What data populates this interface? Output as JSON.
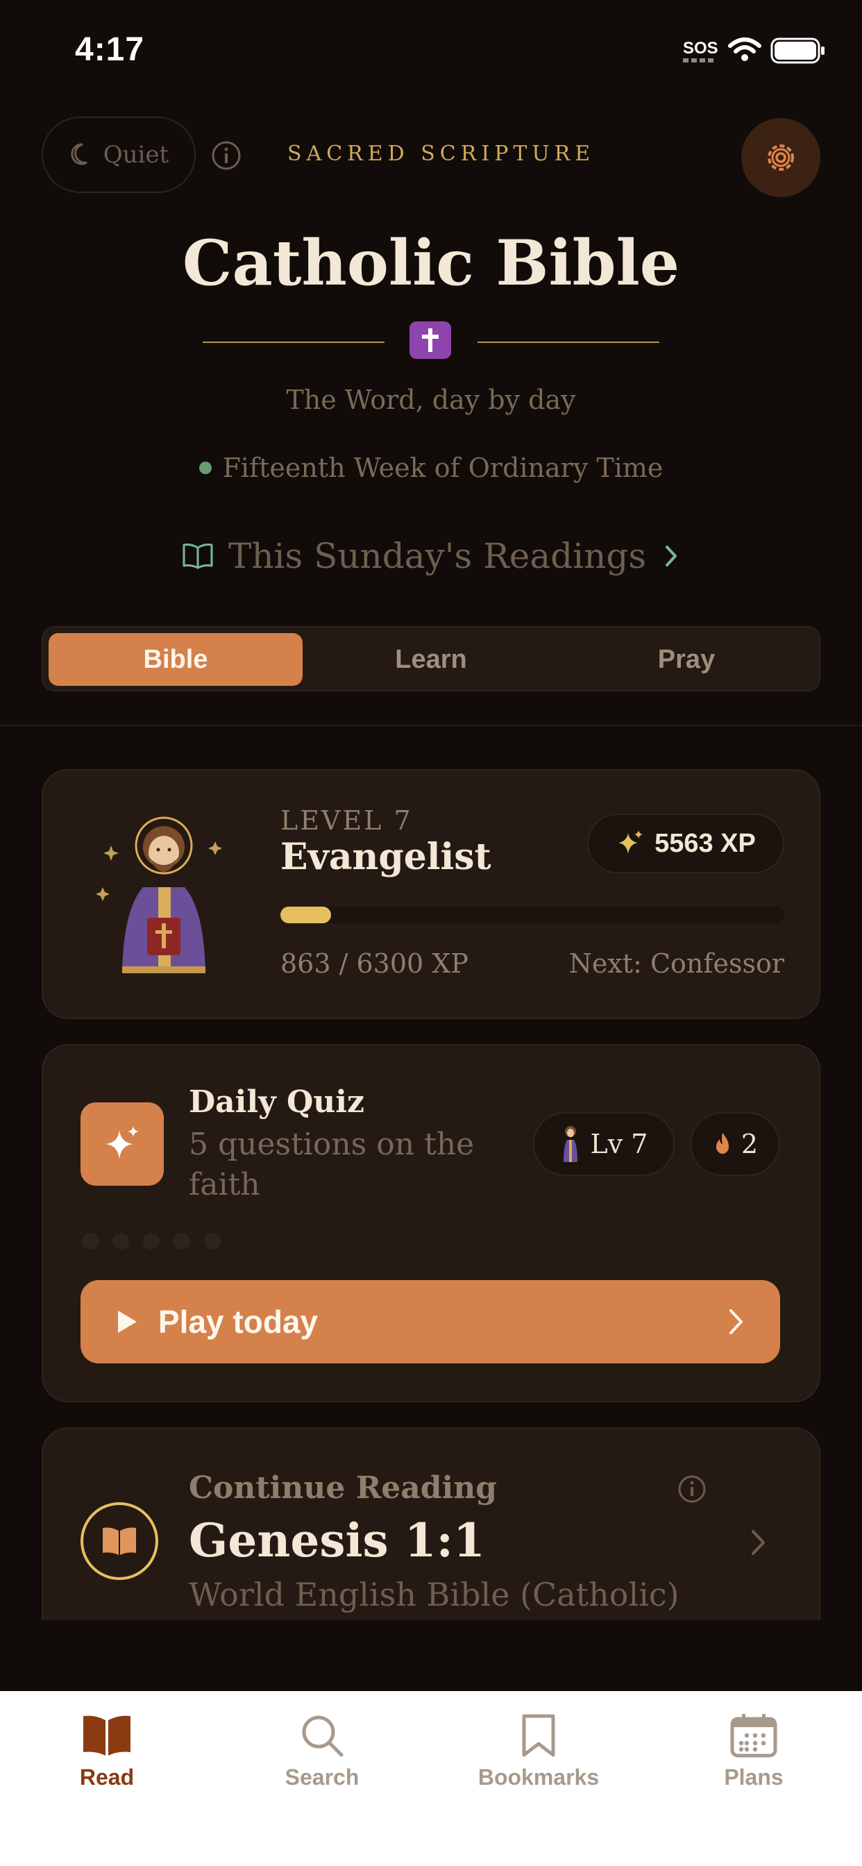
{
  "status_bar": {
    "time": "4:17",
    "sos": "SOS"
  },
  "header": {
    "quiet_label": "Quiet",
    "eyebrow": "SACRED SCRIPTURE",
    "title": "Catholic Bible",
    "subtitle": "The Word, day by day",
    "season": "Fifteenth Week of Ordinary Time",
    "readings_link": "This Sunday's Readings",
    "cross_color": "#8e44ad"
  },
  "segments": [
    {
      "label": "Bible",
      "active": true
    },
    {
      "label": "Learn",
      "active": false
    },
    {
      "label": "Pray",
      "active": false
    }
  ],
  "level_card": {
    "level_label": "LEVEL 7",
    "rank": "Evangelist",
    "xp_total": "5563 XP",
    "progress_text": "863 / 6300 XP",
    "progress_fraction": 0.137,
    "next_rank": "Next: Confessor"
  },
  "quiz": {
    "title": "Daily Quiz",
    "description": "5 questions on the faith",
    "level_pill": "Lv 7",
    "streak": "2",
    "question_dots": 5,
    "play_label": "Play today"
  },
  "continue_reading": {
    "label": "Continue Reading",
    "reference": "Genesis 1:1",
    "version": "World English Bible (Catholic)"
  },
  "tabs": [
    {
      "label": "Read",
      "icon": "book-icon",
      "active": true
    },
    {
      "label": "Search",
      "icon": "search-icon",
      "active": false
    },
    {
      "label": "Bookmarks",
      "icon": "bookmark-icon",
      "active": false
    },
    {
      "label": "Plans",
      "icon": "calendar-icon",
      "active": false
    }
  ],
  "colors": {
    "accent": "#d5814b",
    "gold": "#e6bf5f",
    "background": "#110c09",
    "card": "#241a13"
  }
}
